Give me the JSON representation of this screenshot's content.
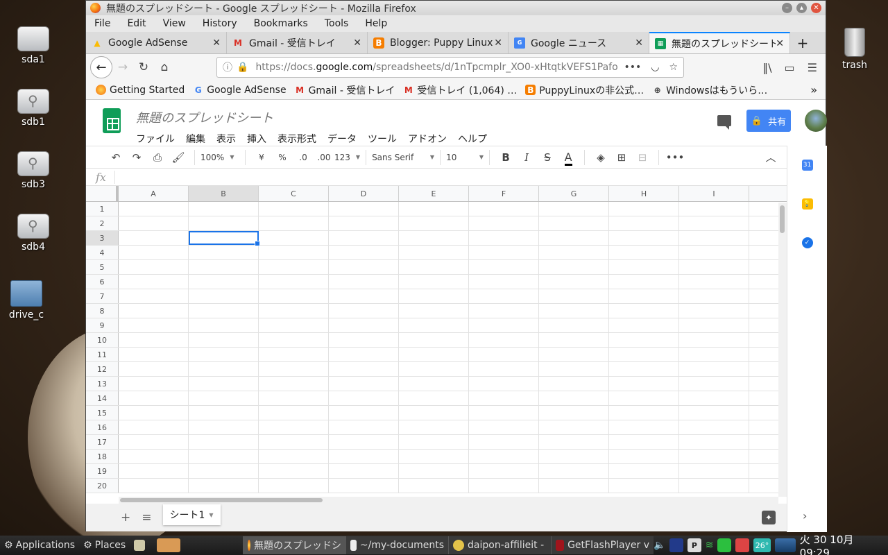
{
  "desktop": {
    "icons": [
      {
        "label": "sda1"
      },
      {
        "label": "sdb1"
      },
      {
        "label": "sdb3"
      },
      {
        "label": "sdb4"
      },
      {
        "label": "drive_c"
      },
      {
        "label": "trash"
      }
    ]
  },
  "window": {
    "title": "無題のスプレッドシート - Google スプレッドシート - Mozilla Firefox",
    "menu": [
      "File",
      "Edit",
      "View",
      "History",
      "Bookmarks",
      "Tools",
      "Help"
    ],
    "tabs": [
      {
        "label": "Google AdSense",
        "icon": "google-icon",
        "color": "#fbbc04"
      },
      {
        "label": "Gmail - 受信トレイ",
        "icon": "gmail-icon",
        "color": "#d93025"
      },
      {
        "label": "Blogger: Puppy Linux",
        "icon": "blogger-icon",
        "color": "#f57d00"
      },
      {
        "label": "Google ニュース",
        "icon": "news-icon",
        "color": "#4285f4"
      },
      {
        "label": "無題のスプレッドシート",
        "icon": "sheets-icon",
        "color": "#0f9d58",
        "active": true
      }
    ],
    "url": {
      "prefix": "https://docs.",
      "domain": "google.com",
      "path": "/spreadsheets/d/1nTpcmplr_XO0-xHtqtkVEFS1Pafo"
    },
    "bookmarks": [
      {
        "label": "Getting Started",
        "icon": "firefox-icon"
      },
      {
        "label": "Google AdSense",
        "icon": "google-icon"
      },
      {
        "label": "Gmail - 受信トレイ",
        "icon": "gmail-icon"
      },
      {
        "label": "受信トレイ (1,064) …",
        "icon": "gmail-icon"
      },
      {
        "label": "PuppyLinuxの非公式…",
        "icon": "blogger-icon"
      },
      {
        "label": "Windowsはもういら…",
        "icon": "globe-icon"
      }
    ]
  },
  "sheets": {
    "doc_title": "無題のスプレッドシート",
    "menu": [
      "ファイル",
      "編集",
      "表示",
      "挿入",
      "表示形式",
      "データ",
      "ツール",
      "アドオン",
      "ヘルプ"
    ],
    "share_label": "共有",
    "toolbar": {
      "zoom": "100%",
      "currency": "¥",
      "percent": "%",
      "dec_less": ".0",
      "dec_more": ".00",
      "number_format": "123",
      "font": "Sans Serif",
      "font_size": "10"
    },
    "fx_label": "fx",
    "columns": [
      "A",
      "B",
      "C",
      "D",
      "E",
      "F",
      "G",
      "H",
      "I"
    ],
    "rows": [
      "1",
      "2",
      "3",
      "4",
      "5",
      "6",
      "7",
      "8",
      "9",
      "10",
      "11",
      "12",
      "13",
      "14",
      "15",
      "16",
      "17",
      "18",
      "19",
      "20"
    ],
    "selected_cell": "B3",
    "sheet_tab": "シート1"
  },
  "taskbar": {
    "menu": "Applications",
    "places": "Places",
    "apps": [
      {
        "label": "無題のスプレッドシ",
        "active": true
      },
      {
        "label": "~/my-documents"
      },
      {
        "label": "daipon-affilieit -"
      },
      {
        "label": "GetFlashPlayer v"
      }
    ],
    "temp": "26°",
    "clock": "火 30 10月 09:29"
  }
}
